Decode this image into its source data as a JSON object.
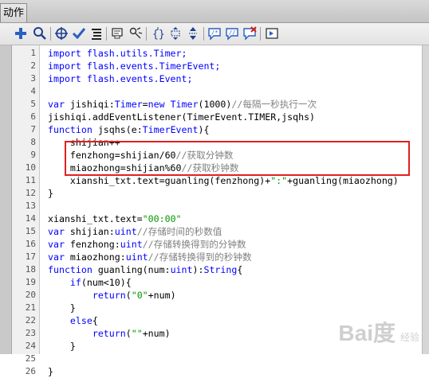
{
  "tab": {
    "label": "动作"
  },
  "toolbar": {
    "buttons": [
      {
        "name": "add-script-icon"
      },
      {
        "name": "find-icon"
      },
      {
        "name": "target-path-icon"
      },
      {
        "name": "check-syntax-icon"
      },
      {
        "name": "auto-format-icon"
      },
      {
        "name": "code-hint-icon"
      },
      {
        "name": "debug-options-icon"
      },
      {
        "name": "collapse-braces-icon"
      },
      {
        "name": "collapse-selection-icon"
      },
      {
        "name": "expand-all-icon"
      },
      {
        "name": "apply-block-comment-icon"
      },
      {
        "name": "apply-line-comment-icon"
      },
      {
        "name": "remove-comment-icon"
      },
      {
        "name": "show-toolbox-icon"
      }
    ]
  },
  "code": {
    "lines": [
      {
        "n": "1",
        "segs": [
          {
            "t": "import flash.utils.Timer;",
            "c": "k"
          }
        ]
      },
      {
        "n": "2",
        "segs": [
          {
            "t": "import flash.events.TimerEvent;",
            "c": "k"
          }
        ]
      },
      {
        "n": "3",
        "segs": [
          {
            "t": "import flash.events.Event;",
            "c": "k"
          }
        ]
      },
      {
        "n": "4",
        "segs": []
      },
      {
        "n": "5",
        "segs": [
          {
            "t": "var ",
            "c": "k"
          },
          {
            "t": "jishiqi:",
            "c": ""
          },
          {
            "t": "Timer",
            "c": "k"
          },
          {
            "t": "=",
            "c": ""
          },
          {
            "t": "new Timer",
            "c": "k"
          },
          {
            "t": "(1000)",
            "c": ""
          },
          {
            "t": "//每隔一秒执行一次",
            "c": "c"
          }
        ]
      },
      {
        "n": "6",
        "segs": [
          {
            "t": "jishiqi.addEventListener(TimerEvent.TIMER,jsqhs)",
            "c": ""
          }
        ]
      },
      {
        "n": "7",
        "segs": [
          {
            "t": "function ",
            "c": "k"
          },
          {
            "t": "jsqhs(e:",
            "c": ""
          },
          {
            "t": "TimerEvent",
            "c": "k"
          },
          {
            "t": "){",
            "c": ""
          }
        ]
      },
      {
        "n": "8",
        "segs": [
          {
            "t": "    shijian++",
            "c": ""
          }
        ]
      },
      {
        "n": "9",
        "segs": [
          {
            "t": "    fenzhong=shijian/60",
            "c": ""
          },
          {
            "t": "//获取分钟数",
            "c": "c"
          }
        ]
      },
      {
        "n": "10",
        "segs": [
          {
            "t": "    miaozhong=shijian%60",
            "c": ""
          },
          {
            "t": "//获取秒钟数",
            "c": "c"
          }
        ]
      },
      {
        "n": "11",
        "segs": [
          {
            "t": "    xianshi_txt.text=guanling(fenzhong)+",
            "c": ""
          },
          {
            "t": "\":\"",
            "c": "s"
          },
          {
            "t": "+guanling(miaozhong)",
            "c": ""
          }
        ]
      },
      {
        "n": "12",
        "segs": [
          {
            "t": "}",
            "c": ""
          }
        ]
      },
      {
        "n": "13",
        "segs": []
      },
      {
        "n": "14",
        "segs": [
          {
            "t": "xianshi_txt.text=",
            "c": ""
          },
          {
            "t": "\"00:00\"",
            "c": "s"
          }
        ]
      },
      {
        "n": "15",
        "segs": [
          {
            "t": "var ",
            "c": "k"
          },
          {
            "t": "shijian:",
            "c": ""
          },
          {
            "t": "uint",
            "c": "k"
          },
          {
            "t": "//存储时间的秒数值",
            "c": "c"
          }
        ]
      },
      {
        "n": "16",
        "segs": [
          {
            "t": "var ",
            "c": "k"
          },
          {
            "t": "fenzhong:",
            "c": ""
          },
          {
            "t": "uint",
            "c": "k"
          },
          {
            "t": "//存储转换得到的分钟数",
            "c": "c"
          }
        ]
      },
      {
        "n": "17",
        "segs": [
          {
            "t": "var ",
            "c": "k"
          },
          {
            "t": "miaozhong:",
            "c": ""
          },
          {
            "t": "uint",
            "c": "k"
          },
          {
            "t": "//存储转换得到的秒钟数",
            "c": "c"
          }
        ]
      },
      {
        "n": "18",
        "segs": [
          {
            "t": "function ",
            "c": "k"
          },
          {
            "t": "guanling(num:",
            "c": ""
          },
          {
            "t": "uint",
            "c": "k"
          },
          {
            "t": "):",
            "c": ""
          },
          {
            "t": "String",
            "c": "k"
          },
          {
            "t": "{",
            "c": ""
          }
        ]
      },
      {
        "n": "19",
        "segs": [
          {
            "t": "    ",
            "c": ""
          },
          {
            "t": "if",
            "c": "k"
          },
          {
            "t": "(num<10){",
            "c": ""
          }
        ]
      },
      {
        "n": "20",
        "segs": [
          {
            "t": "        ",
            "c": ""
          },
          {
            "t": "return",
            "c": "k"
          },
          {
            "t": "(",
            "c": ""
          },
          {
            "t": "\"0\"",
            "c": "s"
          },
          {
            "t": "+num)",
            "c": ""
          }
        ]
      },
      {
        "n": "21",
        "segs": [
          {
            "t": "    }",
            "c": ""
          }
        ]
      },
      {
        "n": "22",
        "segs": [
          {
            "t": "    ",
            "c": ""
          },
          {
            "t": "else",
            "c": "k"
          },
          {
            "t": "{",
            "c": ""
          }
        ]
      },
      {
        "n": "23",
        "segs": [
          {
            "t": "        ",
            "c": ""
          },
          {
            "t": "return",
            "c": "k"
          },
          {
            "t": "(",
            "c": ""
          },
          {
            "t": "\"\"",
            "c": "s"
          },
          {
            "t": "+num)",
            "c": ""
          }
        ]
      },
      {
        "n": "24",
        "segs": [
          {
            "t": "    }",
            "c": ""
          }
        ]
      },
      {
        "n": "25",
        "segs": []
      },
      {
        "n": "26",
        "segs": [
          {
            "t": "}",
            "c": ""
          }
        ]
      }
    ]
  },
  "watermark": {
    "main": "Bai度",
    "sub": "经验"
  },
  "colors": {
    "keyword": "#0000ff",
    "string": "#009900",
    "comment": "#808080",
    "highlight": "#e02020"
  }
}
